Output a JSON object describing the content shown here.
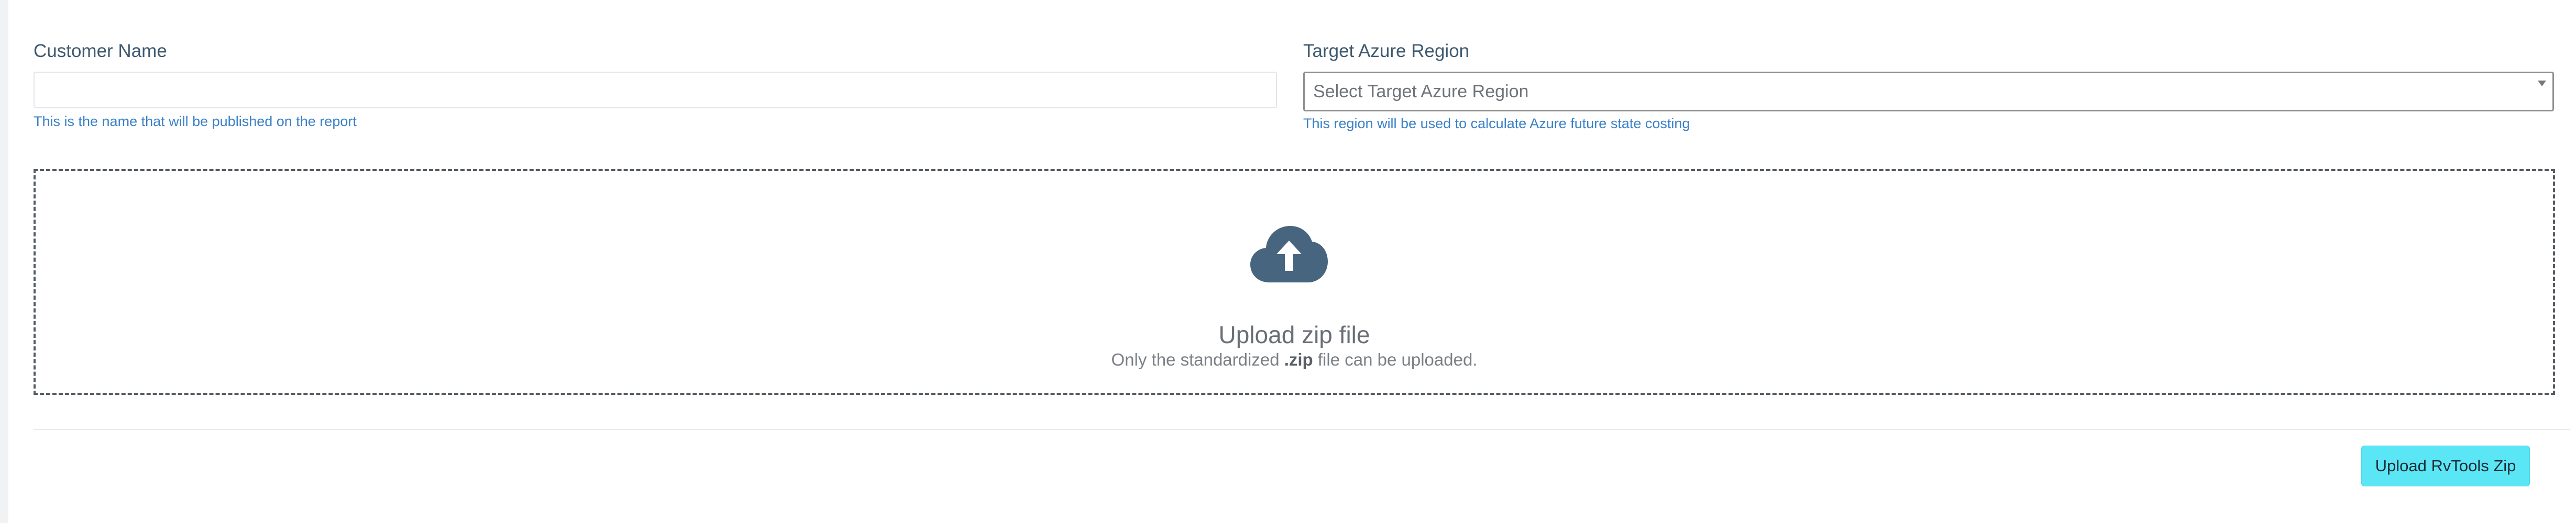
{
  "form": {
    "customer_name": {
      "label": "Customer Name",
      "value": "",
      "placeholder": "",
      "help": "This is the name that will be published on the report"
    },
    "target_region": {
      "label": "Target Azure Region",
      "selected": "Select Target Azure Region",
      "help": "This region will be used to calculate Azure future state costing"
    }
  },
  "dropzone": {
    "icon": "cloud-upload-icon",
    "title": "Upload zip file",
    "subtitle_prefix": "Only the standardized ",
    "subtitle_ext": ".zip",
    "subtitle_suffix": " file can be uploaded."
  },
  "actions": {
    "upload_label": "Upload RvTools Zip"
  },
  "colors": {
    "label": "#3f5a70",
    "help_text": "#3a80c8",
    "cloud_icon": "#48657f",
    "button_bg": "#5be6f5",
    "dropzone_border": "#555b63"
  }
}
